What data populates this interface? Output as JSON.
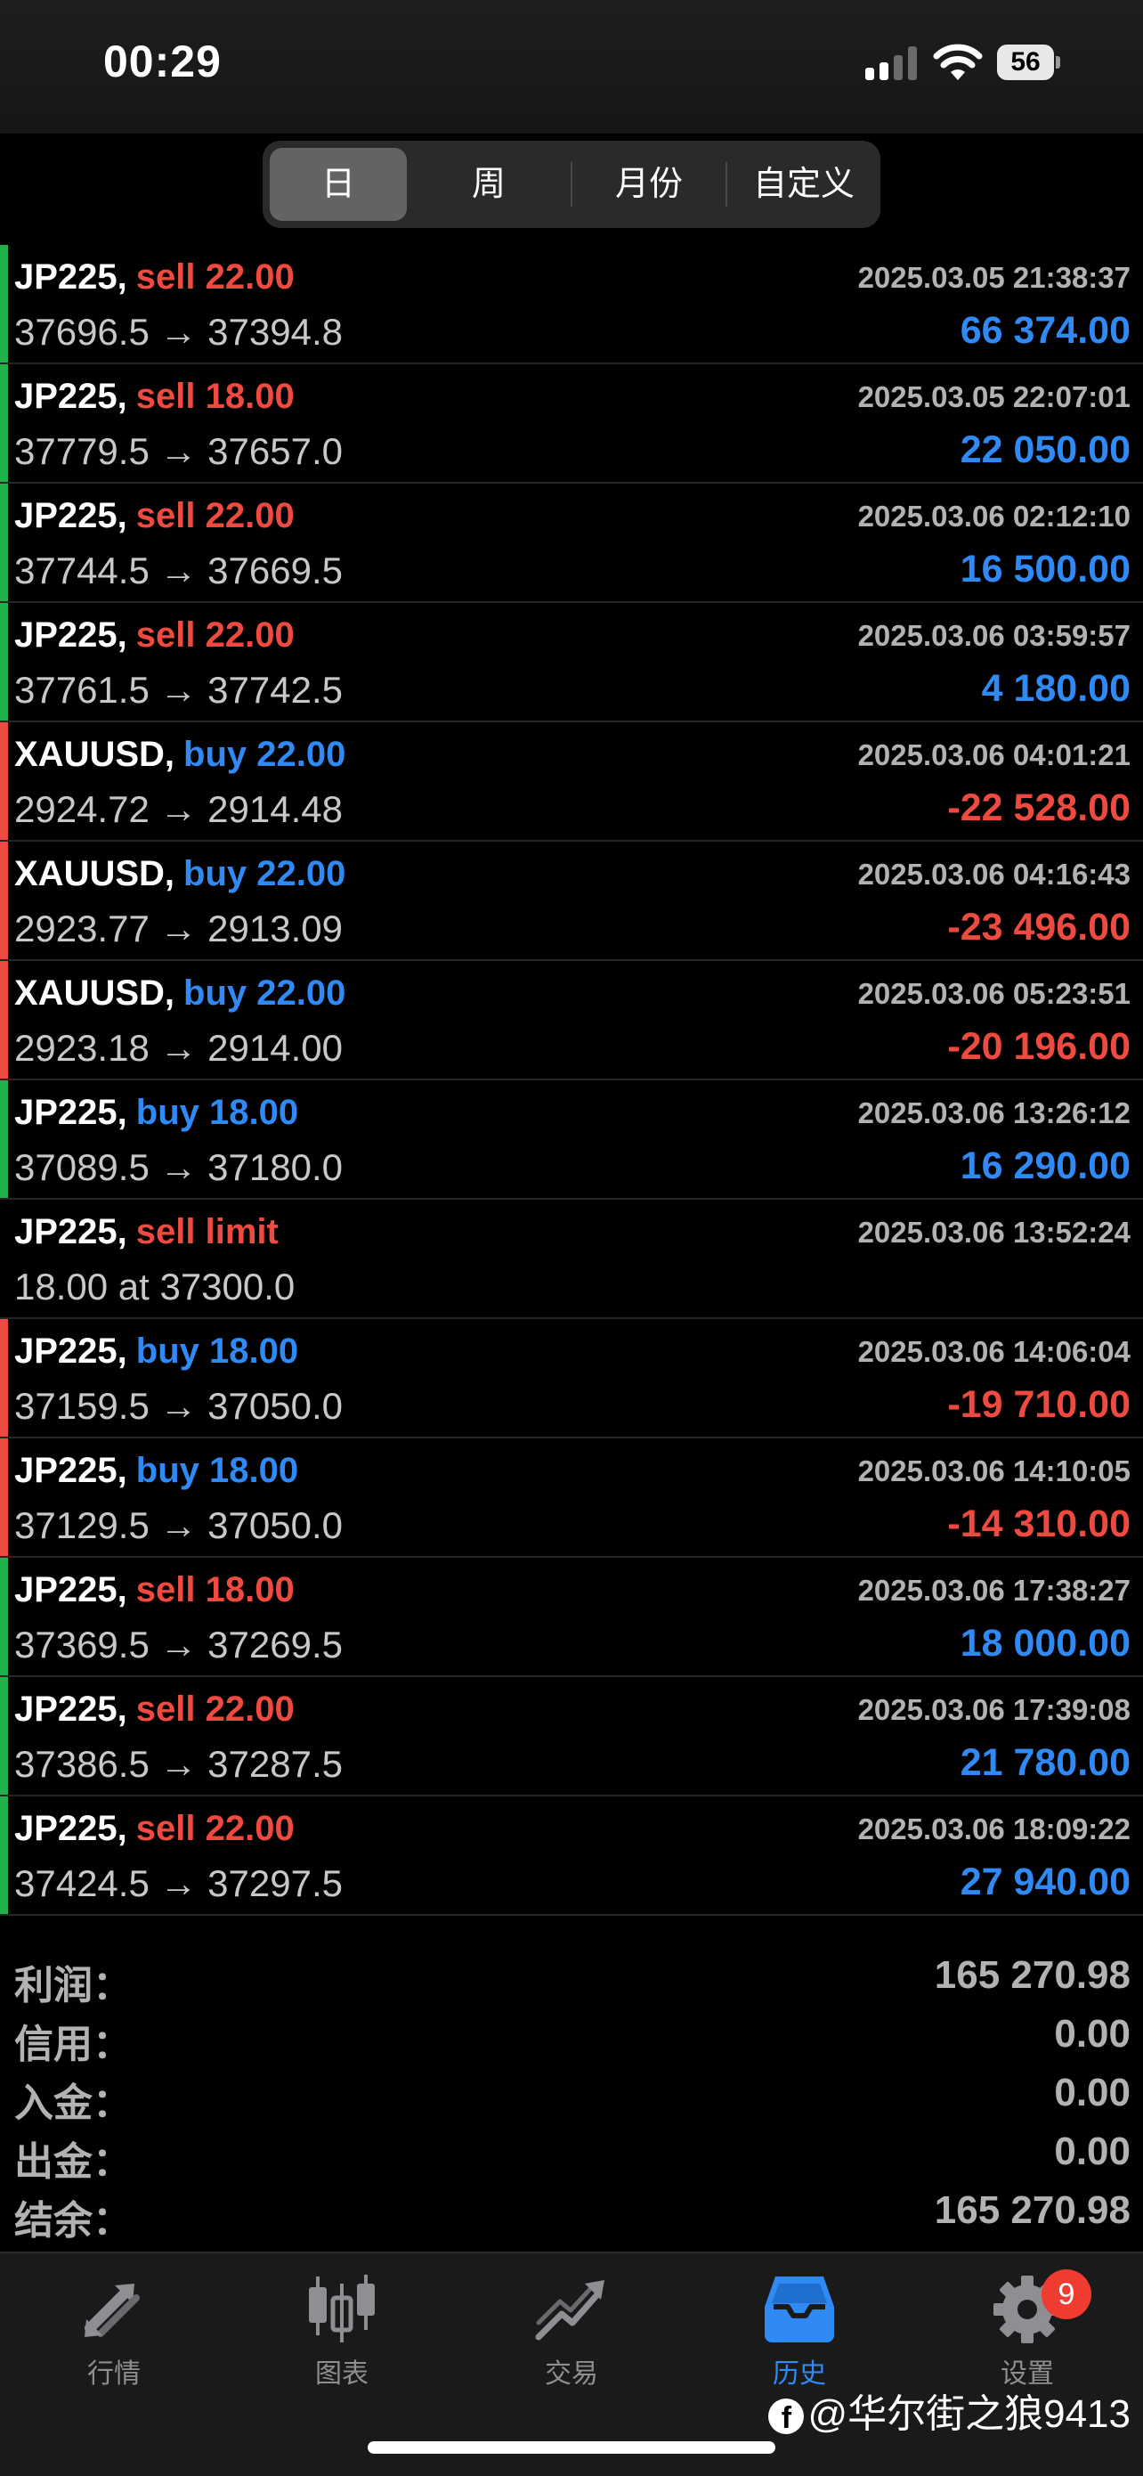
{
  "status_bar": {
    "time": "00:29",
    "battery": "56"
  },
  "period_tabs": [
    {
      "label": "日",
      "active": true
    },
    {
      "label": "周",
      "active": false
    },
    {
      "label": "月份",
      "active": false
    },
    {
      "label": "自定义",
      "active": false
    }
  ],
  "colors": {
    "sell": "#ef4a3f",
    "buy": "#2f8af5",
    "profit": "#2f8af5",
    "loss": "#ef4a3f",
    "bar_profit": "#22b24c",
    "bar_loss": "#ef4a3f",
    "accent": "#2f8af5"
  },
  "deals": [
    {
      "symbol": "JP225,",
      "side": "sell 22.00",
      "side_type": "sell",
      "datetime": "2025.03.05 21:38:37",
      "prices": "37696.5 → 37394.8",
      "profit": "66 374.00",
      "result": "profit"
    },
    {
      "symbol": "JP225,",
      "side": "sell 18.00",
      "side_type": "sell",
      "datetime": "2025.03.05 22:07:01",
      "prices": "37779.5 → 37657.0",
      "profit": "22 050.00",
      "result": "profit"
    },
    {
      "symbol": "JP225,",
      "side": "sell 22.00",
      "side_type": "sell",
      "datetime": "2025.03.06 02:12:10",
      "prices": "37744.5 → 37669.5",
      "profit": "16 500.00",
      "result": "profit"
    },
    {
      "symbol": "JP225,",
      "side": "sell 22.00",
      "side_type": "sell",
      "datetime": "2025.03.06 03:59:57",
      "prices": "37761.5 → 37742.5",
      "profit": "4 180.00",
      "result": "profit"
    },
    {
      "symbol": "XAUUSD,",
      "side": "buy 22.00",
      "side_type": "buy",
      "datetime": "2025.03.06 04:01:21",
      "prices": "2924.72 → 2914.48",
      "profit": "-22 528.00",
      "result": "loss"
    },
    {
      "symbol": "XAUUSD,",
      "side": "buy 22.00",
      "side_type": "buy",
      "datetime": "2025.03.06 04:16:43",
      "prices": "2923.77 → 2913.09",
      "profit": "-23 496.00",
      "result": "loss"
    },
    {
      "symbol": "XAUUSD,",
      "side": "buy 22.00",
      "side_type": "buy",
      "datetime": "2025.03.06 05:23:51",
      "prices": "2923.18 → 2914.00",
      "profit": "-20 196.00",
      "result": "loss"
    },
    {
      "symbol": "JP225,",
      "side": "buy 18.00",
      "side_type": "buy",
      "datetime": "2025.03.06 13:26:12",
      "prices": "37089.5 → 37180.0",
      "profit": "16 290.00",
      "result": "profit"
    },
    {
      "symbol": "JP225,",
      "side": "sell limit",
      "side_type": "sell",
      "datetime": "2025.03.06 13:52:24",
      "prices": "18.00 at 37300.0",
      "profit": "",
      "result": "none"
    },
    {
      "symbol": "JP225,",
      "side": "buy 18.00",
      "side_type": "buy",
      "datetime": "2025.03.06 14:06:04",
      "prices": "37159.5 → 37050.0",
      "profit": "-19 710.00",
      "result": "loss"
    },
    {
      "symbol": "JP225,",
      "side": "buy 18.00",
      "side_type": "buy",
      "datetime": "2025.03.06 14:10:05",
      "prices": "37129.5 → 37050.0",
      "profit": "-14 310.00",
      "result": "loss"
    },
    {
      "symbol": "JP225,",
      "side": "sell 18.00",
      "side_type": "sell",
      "datetime": "2025.03.06 17:38:27",
      "prices": "37369.5 → 37269.5",
      "profit": "18 000.00",
      "result": "profit"
    },
    {
      "symbol": "JP225,",
      "side": "sell 22.00",
      "side_type": "sell",
      "datetime": "2025.03.06 17:39:08",
      "prices": "37386.5 → 37287.5",
      "profit": "21 780.00",
      "result": "profit"
    },
    {
      "symbol": "JP225,",
      "side": "sell 22.00",
      "side_type": "sell",
      "datetime": "2025.03.06 18:09:22",
      "prices": "37424.5 → 37297.5",
      "profit": "27 940.00",
      "result": "profit"
    }
  ],
  "summary": [
    {
      "label": "利润：",
      "value": "165 270.98"
    },
    {
      "label": "信用：",
      "value": "0.00"
    },
    {
      "label": "入金：",
      "value": "0.00"
    },
    {
      "label": "出金：",
      "value": "0.00"
    },
    {
      "label": "结余：",
      "value": "165 270.98"
    }
  ],
  "tab_bar": [
    {
      "label": "行情",
      "icon": "quotes-arrows-icon",
      "active": false
    },
    {
      "label": "图表",
      "icon": "candlestick-chart-icon",
      "active": false
    },
    {
      "label": "交易",
      "icon": "trade-trend-icon",
      "active": false
    },
    {
      "label": "历史",
      "icon": "history-inbox-icon",
      "active": true
    },
    {
      "label": "设置",
      "icon": "settings-gear-icon",
      "active": false,
      "badge": "9"
    }
  ],
  "watermark": "@华尔街之狼9413"
}
